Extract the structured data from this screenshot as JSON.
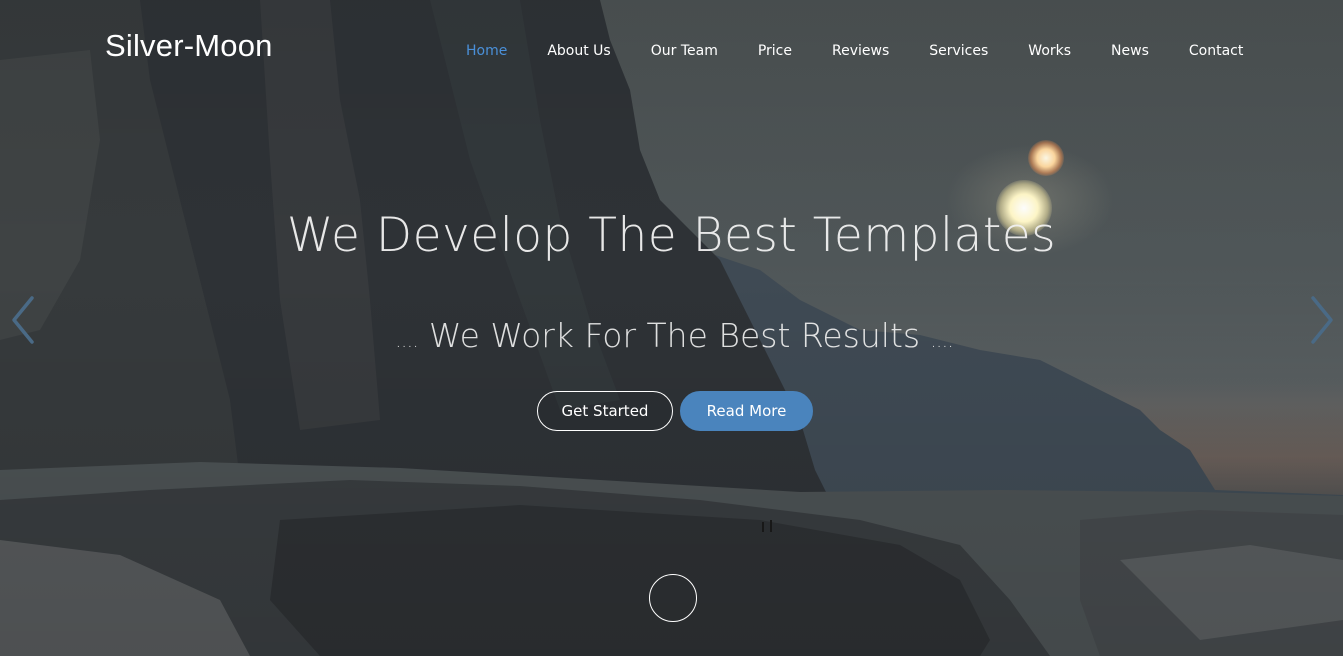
{
  "brand": {
    "name": "Silver-Moon"
  },
  "nav": {
    "items": [
      {
        "label": "Home",
        "active": true
      },
      {
        "label": "About Us"
      },
      {
        "label": "Our Team"
      },
      {
        "label": "Price"
      },
      {
        "label": "Reviews"
      },
      {
        "label": "Services"
      },
      {
        "label": "Works"
      },
      {
        "label": "News"
      },
      {
        "label": "Contact"
      }
    ],
    "active_color": "#4a90d9"
  },
  "hero": {
    "headline": "We Develop The Best Templates",
    "subline_prefix": "....",
    "subline_text": "We Work For The Best Results",
    "subline_suffix": "....",
    "primary_button": "Get Started",
    "secondary_button": "Read More",
    "secondary_button_color": "#4a84bd"
  },
  "icons": {
    "prev": "chevron-left-icon",
    "next": "chevron-right-icon",
    "scroll": "scroll-down-circle-icon"
  }
}
